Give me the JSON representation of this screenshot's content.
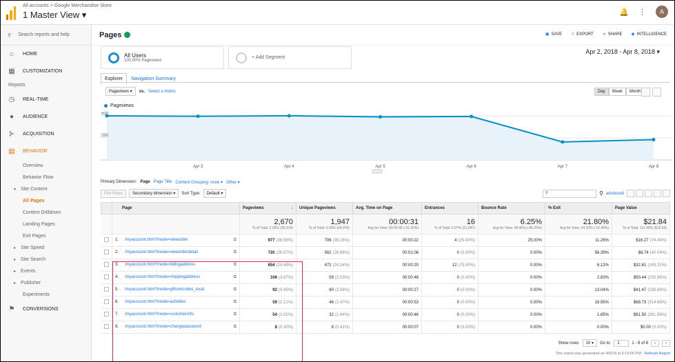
{
  "topbar": {
    "breadcrumb": "All accounts > Google Merchandise Store",
    "view_title": "1 Master View",
    "avatar_initial": "A"
  },
  "sidebar": {
    "search_placeholder": "Search reports and help",
    "home": "HOME",
    "customization": "CUSTOMIZATION",
    "reports_label": "Reports",
    "realtime": "REAL-TIME",
    "audience": "AUDIENCE",
    "acquisition": "ACQUISITION",
    "behavior": "BEHAVIOR",
    "behavior_items": [
      "Overview",
      "Behavior Flow"
    ],
    "site_content": "Site Content",
    "site_content_items": [
      "All Pages",
      "Content Drilldown",
      "Landing Pages",
      "Exit Pages"
    ],
    "more_items": [
      "Site Speed",
      "Site Search",
      "Events",
      "Publisher",
      "Experiments"
    ],
    "conversions": "CONVERSIONS"
  },
  "header": {
    "title": "Pages",
    "save": "SAVE",
    "export": "EXPORT",
    "share": "SHARE",
    "intelligence": "INTELLIGENCE"
  },
  "segment": {
    "name": "All Users",
    "sub": "100.00% Pageviews",
    "add": "+ Add Segment"
  },
  "date_range": "Apr 2, 2018 - Apr 8, 2018",
  "tabs": [
    "Explorer",
    "Navigation Summary"
  ],
  "metric_row": {
    "metric": "Pageviews",
    "vs": "vs.",
    "select": "Select a metric"
  },
  "granularity": [
    "Day",
    "Week",
    "Month"
  ],
  "chart_data": {
    "type": "line",
    "series": [
      {
        "name": "Pageviews",
        "values": [
          500,
          495,
          501,
          488,
          493,
          204,
          230
        ]
      }
    ],
    "x": [
      "",
      "Apr 3",
      "Apr 4",
      "Apr 5",
      "Apr 6",
      "Apr 7",
      "Apr 8"
    ],
    "ylim": [
      0,
      500
    ],
    "yticks": [
      "500",
      "250"
    ],
    "color": "#058dc7"
  },
  "primary_dimension": {
    "label": "Primary Dimension:",
    "page": "Page",
    "page_title": "Page Title",
    "grouping": "Content Grouping: none ▾",
    "other": "Other ▾"
  },
  "toolbar": {
    "plot_rows": "Plot Rows",
    "secondary": "Secondary dimension ▾",
    "sort_type": "Sort Type:",
    "sort_value": "Default ▾",
    "search_value": "?",
    "advanced": "advanced"
  },
  "table": {
    "headers": [
      "Page",
      "Pageviews",
      "Unique Pageviews",
      "Avg. Time on Page",
      "Entrances",
      "Bounce Rate",
      "% Exit",
      "Page Value"
    ],
    "totals": {
      "pageviews": "2,670",
      "pageviews_sub": "% of Total: 2.96% (90,214)",
      "unique": "1,947",
      "unique_sub": "% of Total: 3.00% (64,979)",
      "avgtime": "00:00:31",
      "avgtime_sub": "Avg for View: 00:00:45 (-31.92%)",
      "entrances": "16",
      "entrances_sub": "% of Total: 0.07% (21,947)",
      "bounce": "6.25%",
      "bounce_sub": "Avg for View: 45.46% (-86.25%)",
      "exit": "21.80%",
      "exit_sub": "Avg for View: 24.33% (-10.40%)",
      "value": "$21.84",
      "value_sub": "% of Total: 111.46% ($19.59)"
    },
    "rows": [
      {
        "n": "1.",
        "page": "/myaccount.html?mode=vieworder",
        "pv": "977",
        "pvp": "(36.59%)",
        "up": "706",
        "upp": "(36.26%)",
        "time": "00:00:22",
        "ent": "4",
        "entp": "(25.00%)",
        "br": "25.00%",
        "ex": "11.26%",
        "val": "$16.27",
        "valp": "(74.49%)"
      },
      {
        "n": "2.",
        "page": "/myaccount.html?mode=vieworderdetail",
        "pv": "720",
        "pvp": "(26.97%)",
        "up": "562",
        "upp": "(28.86%)",
        "time": "00:01:06",
        "ent": "0",
        "entp": "(0.00%)",
        "br": "0.00%",
        "ex": "56.39%",
        "val": "$8.74",
        "valp": "(40.04%)"
      },
      {
        "n": "3.",
        "page": "/myaccount.html?mode=billingaddress",
        "pv": "654",
        "pvp": "(24.49%)",
        "up": "472",
        "upp": "(24.24%)",
        "time": "00:00:20",
        "ent": "12",
        "entp": "(75.00%)",
        "br": "0.00%",
        "ex": "6.12%",
        "val": "$32.61",
        "valp": "(149.31%)"
      },
      {
        "n": "4.",
        "page": "/myaccount.html?mode=shippingaddress",
        "pv": "106",
        "pvp": "(3.97%)",
        "up": "59",
        "upp": "(3.03%)",
        "time": "00:00:48",
        "ent": "0",
        "entp": "(0.00%)",
        "br": "0.00%",
        "ex": "2.83%",
        "val": "$50.44",
        "valp": "(230.96%)"
      },
      {
        "n": "5.",
        "page": "/myaccount.html?mode=giftcertcodes_local",
        "pv": "92",
        "pvp": "(3.45%)",
        "up": "60",
        "upp": "(3.08%)",
        "time": "00:00:27",
        "ent": "0",
        "entp": "(0.00%)",
        "br": "0.00%",
        "ex": "13.04%",
        "val": "$41.47",
        "valp": "(189.86%)"
      },
      {
        "n": "6.",
        "page": "/myaccount.html?mode=activities",
        "pv": "59",
        "pvp": "(2.21%)",
        "up": "48",
        "upp": "(2.47%)",
        "time": "00:00:53",
        "ent": "0",
        "entp": "(0.00%)",
        "br": "0.00%",
        "ex": "16.95%",
        "val": "$68.73",
        "valp": "(314.69%)"
      },
      {
        "n": "7.",
        "page": "/myaccount.html?mode=customerinfo",
        "pv": "54",
        "pvp": "(2.02%)",
        "up": "32",
        "upp": "(1.64%)",
        "time": "00:00:46",
        "ent": "0",
        "entp": "(0.00%)",
        "br": "0.00%",
        "ex": "1.85%",
        "val": "$61.50",
        "valp": "(281.58%)"
      },
      {
        "n": "8.",
        "page": "/myaccount.html?mode=changepassword",
        "pv": "8",
        "pvp": "(0.30%)",
        "up": "8",
        "upp": "(0.41%)",
        "time": "00:00:07",
        "ent": "0",
        "entp": "(0.00%)",
        "br": "0.00%",
        "ex": "0.00%",
        "val": "$0.00",
        "valp": "(0.00%)"
      }
    ]
  },
  "footer": {
    "show_rows": "Show rows:",
    "rows_value": "10",
    "goto": "Go to:",
    "goto_value": "1",
    "range": "1 - 8 of 8",
    "generated": "This report was generated on 4/9/18 at 5:14:00 PM -",
    "refresh": "Refresh Report"
  }
}
